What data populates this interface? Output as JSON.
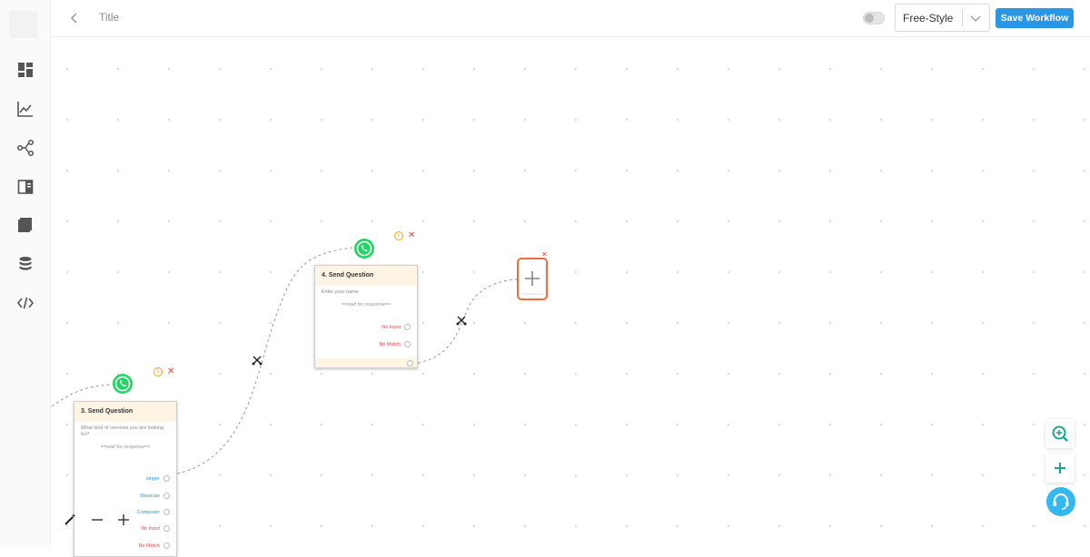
{
  "header": {
    "title": "Title",
    "mode_select": {
      "value": "Free-Style"
    },
    "save_label": "Save Workflow"
  },
  "sidebar": {
    "items": [
      {
        "icon": "dashboard-icon"
      },
      {
        "icon": "analytics-icon"
      },
      {
        "icon": "workflow-icon"
      },
      {
        "icon": "layout-icon"
      },
      {
        "icon": "book-icon"
      },
      {
        "icon": "database-icon"
      },
      {
        "icon": "code-icon"
      }
    ]
  },
  "nodes": [
    {
      "title": "3. Send Question",
      "prompt": "What kind of services you are looking for?",
      "wait": "==wait for response==",
      "options": [
        "singer",
        "Musician",
        "Composer",
        "No Input",
        "No Match"
      ]
    },
    {
      "title": "4. Send Question",
      "prompt": "Enter your name",
      "wait": "==wait for response==",
      "options": [
        "No Input",
        "No Match"
      ]
    }
  ],
  "colors": {
    "accent": "#2a96e6",
    "header_band": "#fdf4e3",
    "danger": "#e04848",
    "warning": "#f3a41c",
    "add_border": "#f26b3a",
    "whatsapp": "#25d366",
    "support": "#33b8f0",
    "fab_icon": "#1aa68c"
  }
}
